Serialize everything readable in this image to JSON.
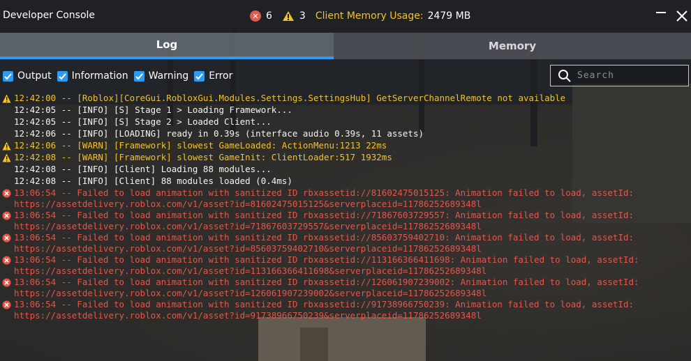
{
  "window": {
    "title": "Developer Console"
  },
  "stats": {
    "error_count": "6",
    "warning_count": "3",
    "memory_label": "Client Memory Usage:",
    "memory_value": "2479 MB"
  },
  "tabs": [
    {
      "label": "Log",
      "active": true
    },
    {
      "label": "Memory",
      "active": false
    }
  ],
  "filters": [
    {
      "label": "Output",
      "checked": true
    },
    {
      "label": "Information",
      "checked": true
    },
    {
      "label": "Warning",
      "checked": true
    },
    {
      "label": "Error",
      "checked": true
    }
  ],
  "search": {
    "placeholder": "Search",
    "value": ""
  },
  "colors": {
    "accent": "#2f9bf0",
    "warning": "#f2c12e",
    "error": "#e0574d",
    "text": "#f5f5f5"
  },
  "log": [
    {
      "type": "warning",
      "text": "12:42:00 -- [Roblox][CoreGui.RobloxGui.Modules.Settings.SettingsHub] GetServerChannelRemote not available"
    },
    {
      "type": "output",
      "text": "12:42:05 -- [INFO] [S] Stage 1 > Loading Framework..."
    },
    {
      "type": "output",
      "text": "12:42:05 -- [INFO] [S] Stage 2 > Loaded Client..."
    },
    {
      "type": "output",
      "text": "12:42:06 -- [INFO] [LOADING] ready in 0.39s (interface audio 0.39s, 11 assets)"
    },
    {
      "type": "warning",
      "text": "12:42:06 -- [WARN] [Framework] slowest GameLoaded: ActionMenu:1213 22ms"
    },
    {
      "type": "warning",
      "text": "12:42:08 -- [WARN] [Framework] slowest GameInit: ClientLoader:517 1932ms"
    },
    {
      "type": "output",
      "text": "12:42:08 -- [INFO] [Client] Loading 88 modules..."
    },
    {
      "type": "output",
      "text": "12:42:08 -- [INFO] [Client] 88 modules loaded (0.4ms)"
    },
    {
      "type": "error",
      "text": "13:06:54 -- Failed to load animation with sanitized ID rbxassetid://81602475015125: Animation failed to load, assetId:\nhttps://assetdelivery.roblox.com/v1/asset?id=81602475015125&serverplaceid=11786252689348l"
    },
    {
      "type": "error",
      "text": "13:06:54 -- Failed to load animation with sanitized ID rbxassetid://71867603729557: Animation failed to load, assetId:\nhttps://assetdelivery.roblox.com/v1/asset?id=71867603729557&serverplaceid=11786252689348l"
    },
    {
      "type": "error",
      "text": "13:06:54 -- Failed to load animation with sanitized ID rbxassetid://85603759402710: Animation failed to load, assetId:\nhttps://assetdelivery.roblox.com/v1/asset?id=85603759402710&serverplaceid=11786252689348l"
    },
    {
      "type": "error",
      "text": "13:06:54 -- Failed to load animation with sanitized ID rbxassetid://113166366411698: Animation failed to load, assetId:\nhttps://assetdelivery.roblox.com/v1/asset?id=113166366411698&serverplaceid=11786252689348l"
    },
    {
      "type": "error",
      "text": "13:06:54 -- Failed to load animation with sanitized ID rbxassetid://126061907239002: Animation failed to load, assetId:\nhttps://assetdelivery.roblox.com/v1/asset?id=126061907239002&serverplaceid=11786252689348l"
    },
    {
      "type": "error",
      "text": "13:06:54 -- Failed to load animation with sanitized ID rbxassetid://91738966750239: Animation failed to load, assetId:\nhttps://assetdelivery.roblox.com/v1/asset?id=91738966750239&serverplaceid=11786252689348l"
    }
  ]
}
